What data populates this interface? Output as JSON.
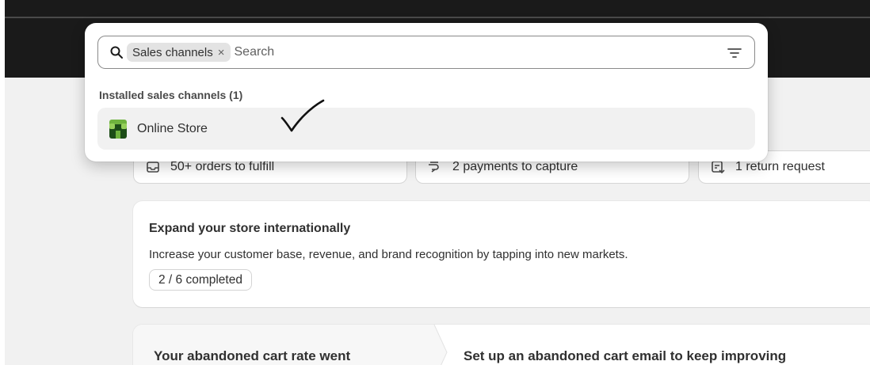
{
  "background_cards": {
    "stats": [
      {
        "icon": "inbox-icon",
        "label": "50+ orders to fulfill"
      },
      {
        "icon": "payment-hand-icon",
        "label": "2 payments to capture"
      },
      {
        "icon": "return-receipt-icon",
        "label": "1 return request"
      }
    ],
    "expand": {
      "title": "Expand your store internationally",
      "description": "Increase your customer base, revenue, and brand recognition by tapping into new markets.",
      "progress": "2 / 6 completed"
    },
    "cart": {
      "left_title": "Your abandoned cart rate went",
      "right_title": "Set up an abandoned cart email to keep improving"
    }
  },
  "popover": {
    "search": {
      "chip_label": "Sales channels",
      "chip_remove": "×",
      "placeholder": "Search",
      "value": ""
    },
    "section_label": "Installed sales channels (1)",
    "channels": [
      {
        "icon": "online-store-icon",
        "label": "Online Store"
      }
    ]
  },
  "colors": {
    "topbar": "#1a1a1a",
    "page_bg": "#f1f1f1",
    "store_icon_green": "#6fb33e",
    "store_icon_dark": "#1d4d18"
  }
}
